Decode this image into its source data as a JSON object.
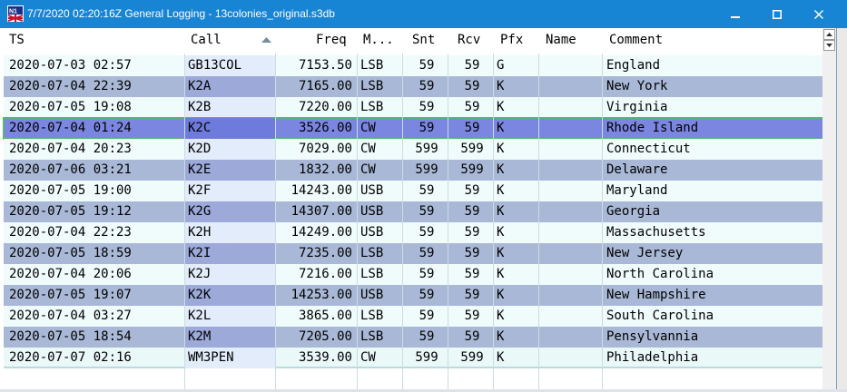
{
  "window": {
    "title": "7/7/2020 02:20:16Z  General Logging - 13colonies_original.s3db",
    "app_icon": "n1mm-logo-icon",
    "controls": [
      "minimize-icon",
      "maximize-icon",
      "close-icon"
    ]
  },
  "grid": {
    "columns": [
      {
        "key": "ts",
        "label": "TS"
      },
      {
        "key": "call",
        "label": "Call"
      },
      {
        "key": "freq",
        "label": "Freq"
      },
      {
        "key": "mode",
        "label": "M..."
      },
      {
        "key": "snt",
        "label": "Snt"
      },
      {
        "key": "rcv",
        "label": "Rcv"
      },
      {
        "key": "pfx",
        "label": "Pfx"
      },
      {
        "key": "name",
        "label": "Name"
      },
      {
        "key": "comment",
        "label": "Comment"
      }
    ],
    "sort_column": "call",
    "sort_direction": "ascending",
    "selected_row": 3,
    "rows": [
      {
        "ts": "2020-07-03 02:57",
        "call": "GB13COL",
        "freq": "7153.50",
        "mode": "LSB",
        "snt": "59",
        "rcv": "59",
        "pfx": "G",
        "name": "",
        "comment": "England"
      },
      {
        "ts": "2020-07-04 22:39",
        "call": "K2A",
        "freq": "7165.00",
        "mode": "LSB",
        "snt": "59",
        "rcv": "59",
        "pfx": "K",
        "name": "",
        "comment": "New York"
      },
      {
        "ts": "2020-07-05 19:08",
        "call": "K2B",
        "freq": "7220.00",
        "mode": "LSB",
        "snt": "59",
        "rcv": "59",
        "pfx": "K",
        "name": "",
        "comment": "Virginia"
      },
      {
        "ts": "2020-07-04 01:24",
        "call": "K2C",
        "freq": "3526.00",
        "mode": "CW",
        "snt": "59",
        "rcv": "59",
        "pfx": "K",
        "name": "",
        "comment": "Rhode Island"
      },
      {
        "ts": "2020-07-04 20:23",
        "call": "K2D",
        "freq": "7029.00",
        "mode": "CW",
        "snt": "599",
        "rcv": "599",
        "pfx": "K",
        "name": "",
        "comment": "Connecticut"
      },
      {
        "ts": "2020-07-06 03:21",
        "call": "K2E",
        "freq": "1832.00",
        "mode": "CW",
        "snt": "599",
        "rcv": "599",
        "pfx": "K",
        "name": "",
        "comment": "Delaware"
      },
      {
        "ts": "2020-07-05 19:00",
        "call": "K2F",
        "freq": "14243.00",
        "mode": "USB",
        "snt": "59",
        "rcv": "59",
        "pfx": "K",
        "name": "",
        "comment": "Maryland"
      },
      {
        "ts": "2020-07-05 19:12",
        "call": "K2G",
        "freq": "14307.00",
        "mode": "USB",
        "snt": "59",
        "rcv": "59",
        "pfx": "K",
        "name": "",
        "comment": "Georgia"
      },
      {
        "ts": "2020-07-04 22:23",
        "call": "K2H",
        "freq": "14249.00",
        "mode": "USB",
        "snt": "59",
        "rcv": "59",
        "pfx": "K",
        "name": "",
        "comment": "Massachusetts"
      },
      {
        "ts": "2020-07-05 18:59",
        "call": "K2I",
        "freq": "7235.00",
        "mode": "LSB",
        "snt": "59",
        "rcv": "59",
        "pfx": "K",
        "name": "",
        "comment": "New Jersey"
      },
      {
        "ts": "2020-07-04 20:06",
        "call": "K2J",
        "freq": "7216.00",
        "mode": "LSB",
        "snt": "59",
        "rcv": "59",
        "pfx": "K",
        "name": "",
        "comment": "North Carolina"
      },
      {
        "ts": "2020-07-05 19:07",
        "call": "K2K",
        "freq": "14253.00",
        "mode": "USB",
        "snt": "59",
        "rcv": "59",
        "pfx": "K",
        "name": "",
        "comment": "New Hampshire"
      },
      {
        "ts": "2020-07-04 03:27",
        "call": "K2L",
        "freq": "3865.00",
        "mode": "LSB",
        "snt": "59",
        "rcv": "59",
        "pfx": "K",
        "name": "",
        "comment": "South Carolina"
      },
      {
        "ts": "2020-07-05 18:54",
        "call": "K2M",
        "freq": "7205.00",
        "mode": "LSB",
        "snt": "59",
        "rcv": "59",
        "pfx": "K",
        "name": "",
        "comment": "Pensylvannia"
      },
      {
        "ts": "2020-07-07 02:16",
        "call": "WM3PEN",
        "freq": "3539.00",
        "mode": "CW",
        "snt": "599",
        "rcv": "599",
        "pfx": "K",
        "name": "",
        "comment": "Philadelphia"
      }
    ]
  },
  "colors": {
    "titlebar": "#1884d4",
    "row_odd": "#f0fbfb",
    "row_even": "#a9b8d6",
    "row_selected": "#7b86e0",
    "selected_border": "#59b37a"
  }
}
